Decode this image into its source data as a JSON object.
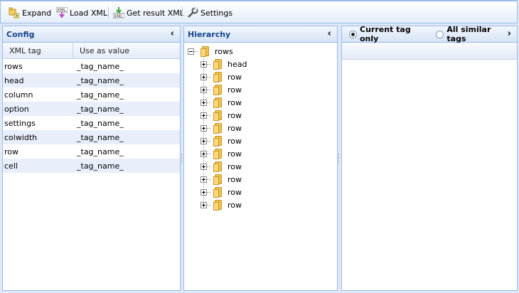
{
  "toolbar": {
    "expand": {
      "label": "Expand",
      "icon": "expand-folder-icon"
    },
    "load_xml": {
      "label": "Load XML",
      "icon": "load-xml-icon"
    },
    "get_result": {
      "label": "Get result XML",
      "icon": "get-xml-icon"
    },
    "settings": {
      "label": "Settings",
      "icon": "wrench-icon"
    }
  },
  "config": {
    "title": "Config",
    "collapse": "‹",
    "columns": [
      "XML tag",
      "Use as value"
    ],
    "rows": [
      {
        "tag": "rows",
        "value": "_tag_name_"
      },
      {
        "tag": "head",
        "value": "_tag_name_"
      },
      {
        "tag": "column",
        "value": "_tag_name_"
      },
      {
        "tag": "option",
        "value": "_tag_name_"
      },
      {
        "tag": "settings",
        "value": "_tag_name_"
      },
      {
        "tag": "colwidth",
        "value": "_tag_name_"
      },
      {
        "tag": "row",
        "value": "_tag_name_"
      },
      {
        "tag": "cell",
        "value": "_tag_name_"
      }
    ]
  },
  "hierarchy": {
    "title": "Hierarchy",
    "collapse": "‹",
    "root": "rows",
    "children": [
      "head",
      "row",
      "row",
      "row",
      "row",
      "row",
      "row",
      "row",
      "row",
      "row",
      "row",
      "row"
    ]
  },
  "details": {
    "option_current": "Current tag only",
    "option_all": "All similar tags",
    "expand": "›"
  }
}
